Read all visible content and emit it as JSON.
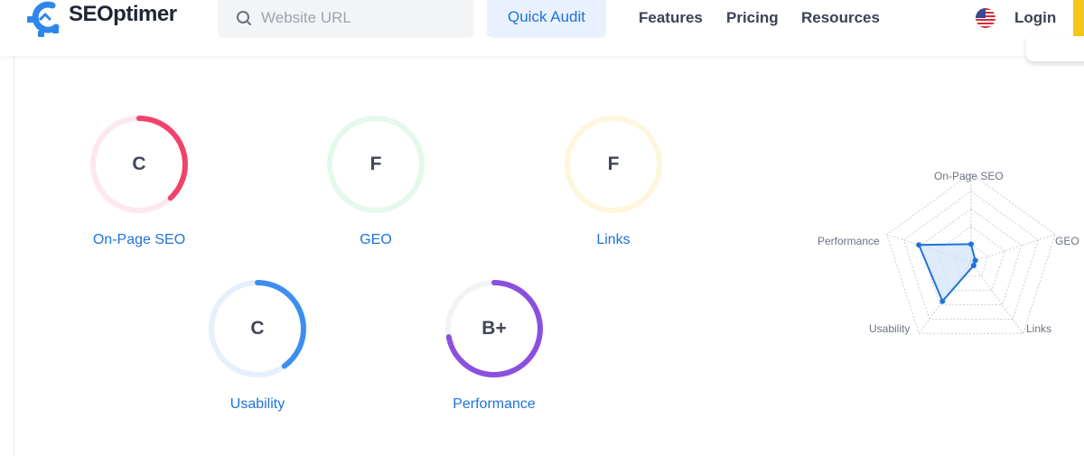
{
  "header": {
    "brand": "SEOptimer",
    "search": {
      "placeholder": "Website URL",
      "value": ""
    },
    "quick_audit_label": "Quick Audit",
    "nav": [
      {
        "label": "Features"
      },
      {
        "label": "Pricing"
      },
      {
        "label": "Resources"
      }
    ],
    "login_label": "Login",
    "flag_icon": "us-flag-icon",
    "cta_color": "#f5c518"
  },
  "scores": [
    {
      "label": "On-Page SEO",
      "grade": "C",
      "progress": 0.38,
      "color": "#f0436b",
      "track": "#fde8ee"
    },
    {
      "label": "GEO",
      "grade": "F",
      "progress": 0.0,
      "color": "#2ecc71",
      "track": "#e5f8ec"
    },
    {
      "label": "Links",
      "grade": "F",
      "progress": 0.0,
      "color": "#f5c518",
      "track": "#fef6dd"
    },
    {
      "label": "Usability",
      "grade": "C",
      "progress": 0.4,
      "color": "#3d8ef0",
      "track": "#e6f0fc"
    },
    {
      "label": "Performance",
      "grade": "B+",
      "progress": 0.72,
      "color": "#8b4fe0",
      "track": "#f2f2f7"
    }
  ],
  "chart_data": {
    "type": "radar",
    "axes": [
      "On-Page SEO",
      "GEO",
      "Links",
      "Usability",
      "Performance"
    ],
    "values": [
      0.2,
      0.05,
      0.05,
      0.55,
      0.62
    ],
    "range": [
      0,
      1
    ],
    "grid_levels": 5,
    "line_color": "#1e73d8",
    "fill_color": "#cfe2fa"
  }
}
